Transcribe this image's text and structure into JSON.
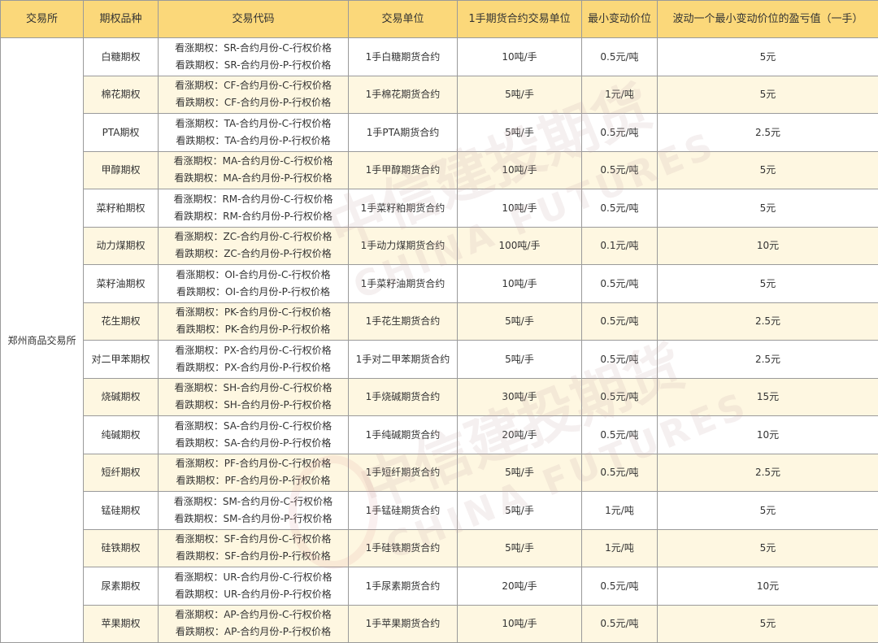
{
  "headers": [
    "交易所",
    "期权品种",
    "交易代码",
    "交易单位",
    "1手期货合约交易单位",
    "最小变动价位",
    "波动一个最小变动价位的盈亏值（一手）"
  ],
  "exchange": "郑州商品交易所",
  "watermark": {
    "cn": "中信建投期货",
    "en": "CHINA FUTURES"
  },
  "rows": [
    {
      "name": "白糖期权",
      "call": "看涨期权：SR-合约月份-C-行权价格",
      "put": "看跌期权：SR-合约月份-P-行权价格",
      "unit": "1手白糖期货合约",
      "futures_unit": "10吨/手",
      "tick": "0.5元/吨",
      "value": "5元"
    },
    {
      "name": "棉花期权",
      "call": "看涨期权：CF-合约月份-C-行权价格",
      "put": "看跌期权：CF-合约月份-P-行权价格",
      "unit": "1手棉花期货合约",
      "futures_unit": "5吨/手",
      "tick": "1元/吨",
      "value": "5元"
    },
    {
      "name": "PTA期权",
      "call": "看涨期权：TA-合约月份-C-行权价格",
      "put": "看跌期权：TA-合约月份-P-行权价格",
      "unit": "1手PTA期货合约",
      "futures_unit": "5吨/手",
      "tick": "0.5元/吨",
      "value": "2.5元"
    },
    {
      "name": "甲醇期权",
      "call": "看涨期权：MA-合约月份-C-行权价格",
      "put": "看跌期权：MA-合约月份-P-行权价格",
      "unit": "1手甲醇期货合约",
      "futures_unit": "10吨/手",
      "tick": "0.5元/吨",
      "value": "5元"
    },
    {
      "name": "菜籽粕期权",
      "call": "看涨期权：RM-合约月份-C-行权价格",
      "put": "看跌期权：RM-合约月份-P-行权价格",
      "unit": "1手菜籽粕期货合约",
      "futures_unit": "10吨/手",
      "tick": "0.5元/吨",
      "value": "5元"
    },
    {
      "name": "动力煤期权",
      "call": "看涨期权：ZC-合约月份-C-行权价格",
      "put": "看跌期权：ZC-合约月份-P-行权价格",
      "unit": "1手动力煤期货合约",
      "futures_unit": "100吨/手",
      "tick": "0.1元/吨",
      "value": "10元"
    },
    {
      "name": "菜籽油期权",
      "call": "看涨期权：OI-合约月份-C-行权价格",
      "put": "看跌期权：OI-合约月份-P-行权价格",
      "unit": "1手菜籽油期货合约",
      "futures_unit": "10吨/手",
      "tick": "0.5元/吨",
      "value": "5元"
    },
    {
      "name": "花生期权",
      "call": "看涨期权：PK-合约月份-C-行权价格",
      "put": "看跌期权：PK-合约月份-P-行权价格",
      "unit": "1手花生期货合约",
      "futures_unit": "5吨/手",
      "tick": "0.5元/吨",
      "value": "2.5元"
    },
    {
      "name": "对二甲苯期权",
      "call": "看涨期权：PX-合约月份-C-行权价格",
      "put": "看跌期权：PX-合约月份-P-行权价格",
      "unit": "1手对二甲苯期货合约",
      "futures_unit": "5吨/手",
      "tick": "0.5元/吨",
      "value": "2.5元"
    },
    {
      "name": "烧碱期权",
      "call": "看涨期权：SH-合约月份-C-行权价格",
      "put": "看跌期权：SH-合约月份-P-行权价格",
      "unit": "1手烧碱期货合约",
      "futures_unit": "30吨/手",
      "tick": "0.5元/吨",
      "value": "15元"
    },
    {
      "name": "纯碱期权",
      "call": "看涨期权：SA-合约月份-C-行权价格",
      "put": "看跌期权：SA-合约月份-P-行权价格",
      "unit": "1手纯碱期货合约",
      "futures_unit": "20吨/手",
      "tick": "0.5元/吨",
      "value": "10元"
    },
    {
      "name": "短纤期权",
      "call": "看涨期权：PF-合约月份-C-行权价格",
      "put": "看跌期权：PF-合约月份-P-行权价格",
      "unit": "1手短纤期货合约",
      "futures_unit": "5吨/手",
      "tick": "0.5元/吨",
      "value": "2.5元"
    },
    {
      "name": "锰硅期权",
      "call": "看涨期权：SM-合约月份-C-行权价格",
      "put": "看跌期权：SM-合约月份-P-行权价格",
      "unit": "1手锰硅期货合约",
      "futures_unit": "5吨/手",
      "tick": "1元/吨",
      "value": "5元"
    },
    {
      "name": "硅铁期权",
      "call": "看涨期权：SF-合约月份-C-行权价格",
      "put": "看跌期权：SF-合约月份-P-行权价格",
      "unit": "1手硅铁期货合约",
      "futures_unit": "5吨/手",
      "tick": "1元/吨",
      "value": "5元"
    },
    {
      "name": "尿素期权",
      "call": "看涨期权：UR-合约月份-C-行权价格",
      "put": "看跌期权：UR-合约月份-P-行权价格",
      "unit": "1手尿素期货合约",
      "futures_unit": "20吨/手",
      "tick": "0.5元/吨",
      "value": "10元"
    },
    {
      "name": "苹果期权",
      "call": "看涨期权：AP-合约月份-C-行权价格",
      "put": "看跌期权：AP-合约月份-P-行权价格",
      "unit": "1手苹果期货合约",
      "futures_unit": "10吨/手",
      "tick": "0.5元/吨",
      "value": "5元"
    }
  ]
}
